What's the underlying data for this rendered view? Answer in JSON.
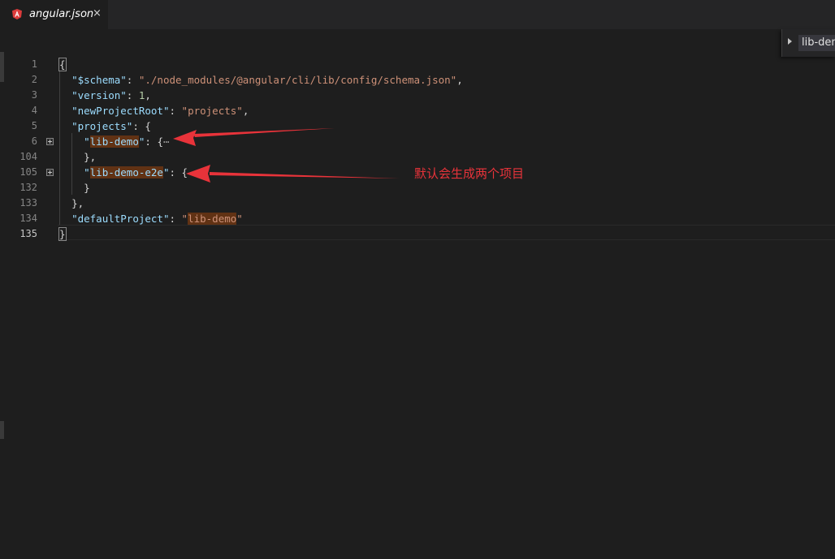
{
  "tab": {
    "label": "angular.json",
    "close_glyph": "×",
    "icon": "angular-icon"
  },
  "breadcrumb": {
    "item": "lib-demo"
  },
  "annotation": {
    "text": "默认会生成两个项目",
    "color": "#e8333a"
  },
  "lines": {
    "l1": {
      "number": "1"
    },
    "l2": {
      "number": "2",
      "key": "\"$schema\"",
      "value": "\"./node_modules/@angular/cli/lib/config/schema.json\""
    },
    "l3": {
      "number": "3",
      "key": "\"version\"",
      "value": "1"
    },
    "l4": {
      "number": "4",
      "key": "\"newProjectRoot\"",
      "value": "\"projects\""
    },
    "l5": {
      "number": "5",
      "key": "\"projects\""
    },
    "l6": {
      "number": "6",
      "key_name": "lib-demo",
      "ellipsis": "⋯"
    },
    "l104": {
      "number": "104"
    },
    "l105": {
      "number": "105",
      "key_name": "lib-demo-e2e"
    },
    "l132": {
      "number": "132"
    },
    "l133": {
      "number": "133"
    },
    "l134": {
      "number": "134",
      "key": "\"defaultProject\"",
      "value_name": "lib-demo"
    },
    "l135": {
      "number": "135"
    }
  },
  "colors": {
    "background": "#1e1e1e",
    "key": "#9cdcfe",
    "string": "#ce9178",
    "number": "#b5cea8",
    "highlight": "#613214",
    "arrow": "#e8333a"
  }
}
